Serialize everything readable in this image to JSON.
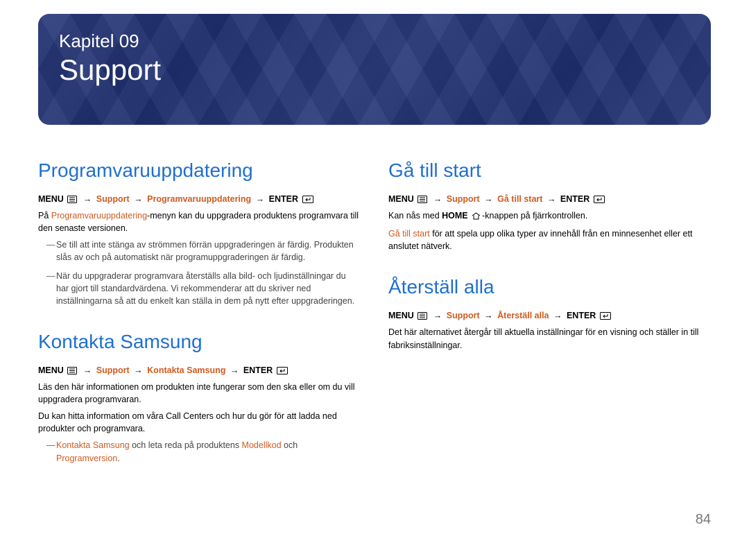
{
  "banner": {
    "chapter_label": "Kapitel 09",
    "chapter_title": "Support"
  },
  "left": {
    "sec1": {
      "heading": "Programvaruuppdatering",
      "menu_prefix": "MENU",
      "menu_p1": "Support",
      "menu_p2": "Programvaruuppdatering",
      "menu_suffix": "ENTER",
      "body_pre": "På ",
      "body_hl": "Programvaruuppdatering",
      "body_post": "-menyn kan du uppgradera produktens programvara till den senaste versionen.",
      "note1": "Se till att inte stänga av strömmen förrän uppgraderingen är färdig. Produkten slås av och på automatiskt när programuppgraderingen är färdig.",
      "note2": "När du uppgraderar programvara återställs alla bild- och ljudinställningar du har gjort till standardvärdena. Vi rekommenderar att du skriver ned inställningarna så att du enkelt kan ställa in dem på nytt efter uppgraderingen."
    },
    "sec2": {
      "heading": "Kontakta Samsung",
      "menu_prefix": "MENU",
      "menu_p1": "Support",
      "menu_p2": "Kontakta Samsung",
      "menu_suffix": "ENTER",
      "body1": "Läs den här informationen om produkten inte fungerar som den ska eller om du vill uppgradera programvaran.",
      "body2": "Du kan hitta information om våra Call Centers och hur du gör för att ladda ned produkter och programvara.",
      "note_pre": "",
      "note_hl1": "Kontakta Samsung",
      "note_mid": " och leta reda på produktens ",
      "note_hl2": "Modellkod",
      "note_mid2": " och ",
      "note_hl3": "Programversion",
      "note_post": "."
    }
  },
  "right": {
    "sec1": {
      "heading": "Gå till start",
      "menu_prefix": "MENU",
      "menu_p1": "Support",
      "menu_p2": "Gå till start",
      "menu_suffix": "ENTER",
      "body1_pre": "Kan nås med ",
      "body1_bold": "HOME",
      "body1_post": "-knappen på fjärrkontrollen.",
      "body2_hl": "Gå till start",
      "body2_post": " för att spela upp olika typer av innehåll från en minnesenhet eller ett anslutet nätverk."
    },
    "sec2": {
      "heading": "Återställ alla",
      "menu_prefix": "MENU",
      "menu_p1": "Support",
      "menu_p2": "Återställ alla",
      "menu_suffix": "ENTER",
      "body": "Det här alternativet återgår till aktuella inställningar för en visning och ställer in till fabriksinställningar."
    }
  },
  "page_number": "84"
}
